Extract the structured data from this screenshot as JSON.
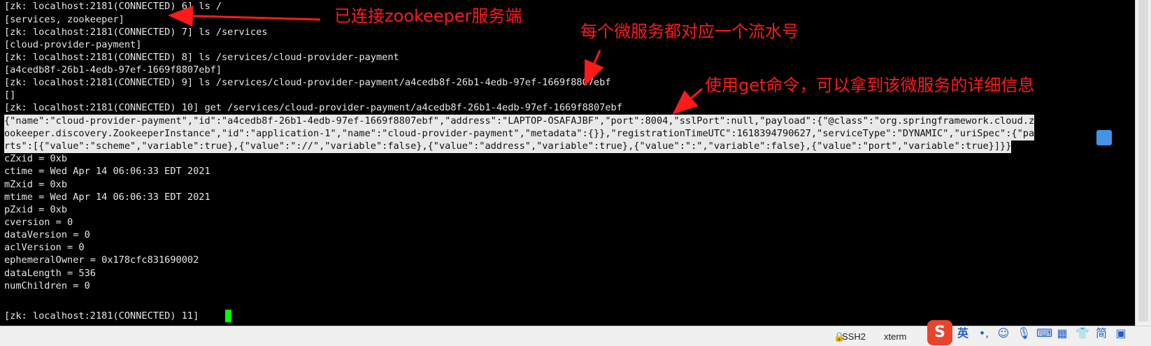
{
  "terminal": {
    "lines": [
      "[zk: localhost:2181(CONNECTED) 6] ls /",
      "[services, zookeeper]",
      "[zk: localhost:2181(CONNECTED) 7] ls /services",
      "[cloud-provider-payment]",
      "[zk: localhost:2181(CONNECTED) 8] ls /services/cloud-provider-payment",
      "[a4cedb8f-26b1-4edb-97ef-1669f8807ebf]",
      "[zk: localhost:2181(CONNECTED) 9] ls /services/cloud-provider-payment/a4cedb8f-26b1-4edb-97ef-1669f8807ebf",
      "[]",
      "[zk: localhost:2181(CONNECTED) 10] get /services/cloud-provider-payment/a4cedb8f-26b1-4edb-97ef-1669f8807ebf",
      "{\"name\":\"cloud-provider-payment\",\"id\":\"a4cedb8f-26b1-4edb-97ef-1669f8807ebf\",\"address\":\"LAPTOP-OSAFAJBF\",\"port\":8004,\"sslPort\":null,\"payload\":{\"@class\":\"org.springframework.cloud.z",
      "ookeeper.discovery.ZookeeperInstance\",\"id\":\"application-1\",\"name\":\"cloud-provider-payment\",\"metadata\":{}},\"registrationTimeUTC\":1618394790627,\"serviceType\":\"DYNAMIC\",\"uriSpec\":{\"pa",
      "rts\":[{\"value\":\"scheme\",\"variable\":true},{\"value\":\"://\",\"variable\":false},{\"value\":\"address\",\"variable\":true},{\"value\":\":\",\"variable\":false},{\"value\":\"port\",\"variable\":true}]}}",
      "cZxid = 0xb",
      "ctime = Wed Apr 14 06:06:33 EDT 2021",
      "mZxid = 0xb",
      "mtime = Wed Apr 14 06:06:33 EDT 2021",
      "pZxid = 0xb",
      "cversion = 0",
      "dataVersion = 0",
      "aclVersion = 0",
      "ephemeralOwner = 0x178cfc831690002",
      "dataLength = 536",
      "numChildren = 0",
      "[zk: localhost:2181(CONNECTED) 11] "
    ]
  },
  "annotations": {
    "connected": "已连接zookeeper服务端",
    "serial": "每个微服务都对应一个流水号",
    "get_info": "使用get命令，可以拿到该微服务的详细信息"
  },
  "statusbar": {
    "ssh": "SSH2",
    "term": "xterm"
  },
  "ime": {
    "lang": "英",
    "logo": "S"
  },
  "colors": {
    "annotation": "#ff1a1a",
    "cursor": "#00ff00",
    "selection": "#e9e9e9"
  }
}
